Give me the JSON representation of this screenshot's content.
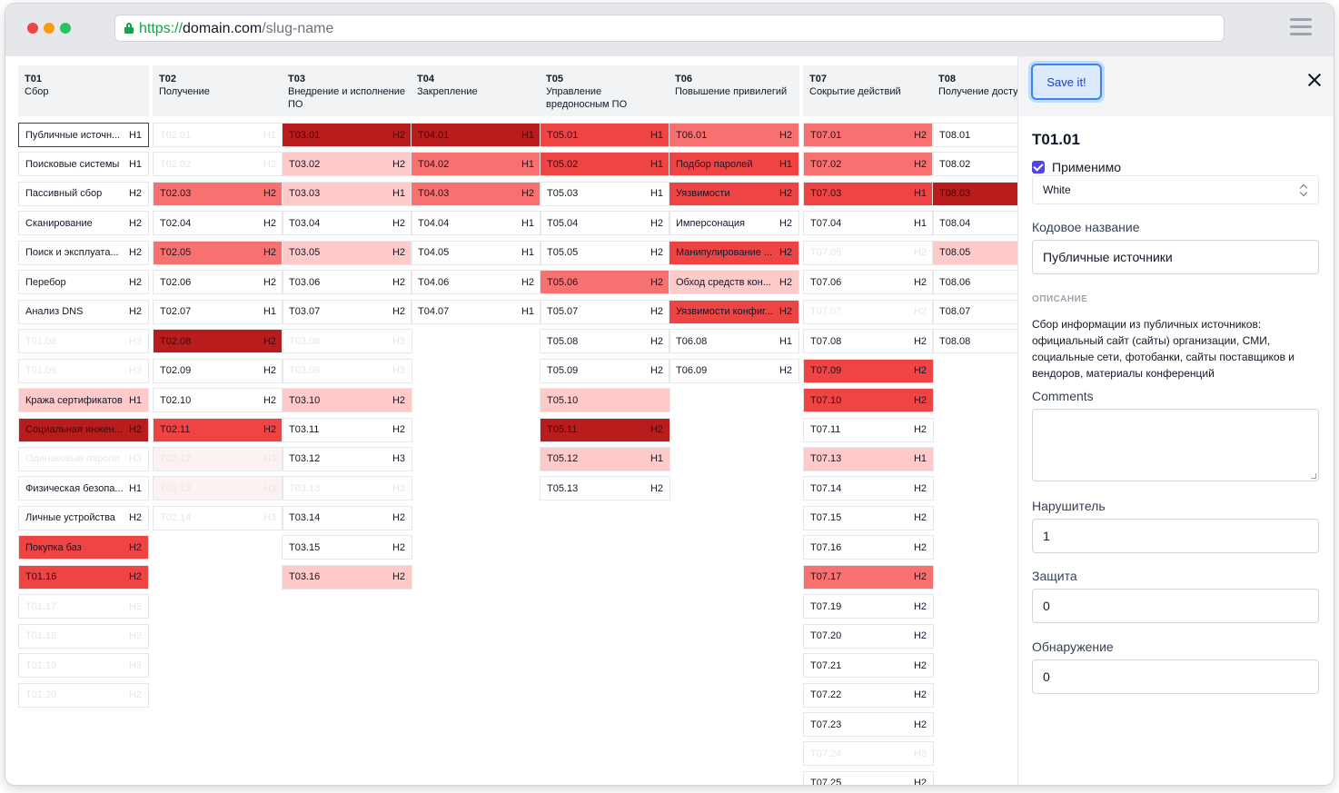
{
  "browser": {
    "url_protocol": "https://",
    "url_host": "domain.com",
    "url_path": "/slug-name"
  },
  "columns": [
    {
      "code": "T01",
      "title": "Сбор",
      "items": [
        {
          "id": "Публичные источн...",
          "level": "H1",
          "state": "sel"
        },
        {
          "id": "Поисковые системы",
          "level": "H1",
          "state": ""
        },
        {
          "id": "Пассивный сбор",
          "level": "H2",
          "state": ""
        },
        {
          "id": "Сканирование",
          "level": "H2",
          "state": ""
        },
        {
          "id": "Поиск и эксплуата...",
          "level": "H2",
          "state": ""
        },
        {
          "id": "Перебор",
          "level": "H2",
          "state": ""
        },
        {
          "id": "Анализ DNS",
          "level": "H2",
          "state": ""
        },
        {
          "id": "T01.08",
          "level": "H3",
          "state": "faded"
        },
        {
          "id": "T01.09",
          "level": "H3",
          "state": "faded"
        },
        {
          "id": "Кража сертификатов",
          "level": "H1",
          "state": "l1"
        },
        {
          "id": "Социальная инжен...",
          "level": "H2",
          "state": "l4"
        },
        {
          "id": "Одинаковые пароли",
          "level": "H3",
          "state": "faded"
        },
        {
          "id": "Физическая безопа...",
          "level": "H1",
          "state": ""
        },
        {
          "id": "Личные устройства",
          "level": "H2",
          "state": ""
        },
        {
          "id": "Покупка баз",
          "level": "H2",
          "state": "l3"
        },
        {
          "id": "T01.16",
          "level": "H2",
          "state": "l3"
        },
        {
          "id": "T01.17",
          "level": "H3",
          "state": "faded"
        },
        {
          "id": "T01.18",
          "level": "H2",
          "state": "faded"
        },
        {
          "id": "T01.19",
          "level": "H3",
          "state": "faded"
        },
        {
          "id": "T01.20",
          "level": "H2",
          "state": "faded"
        }
      ]
    },
    {
      "code": "T02",
      "title": "Получение",
      "items": [
        {
          "id": "T02.01",
          "level": "H1",
          "state": "faded"
        },
        {
          "id": "T02.02",
          "level": "H2",
          "state": "faded"
        },
        {
          "id": "T02.03",
          "level": "H2",
          "state": "l2"
        },
        {
          "id": "T02.04",
          "level": "H2",
          "state": ""
        },
        {
          "id": "T02.05",
          "level": "H2",
          "state": "l2"
        },
        {
          "id": "T02.06",
          "level": "H2",
          "state": ""
        },
        {
          "id": "T02.07",
          "level": "H1",
          "state": ""
        },
        {
          "id": "T02.08",
          "level": "H2",
          "state": "l4"
        },
        {
          "id": "T02.09",
          "level": "H2",
          "state": ""
        },
        {
          "id": "T02.10",
          "level": "H2",
          "state": ""
        },
        {
          "id": "T02.11",
          "level": "H2",
          "state": "l3"
        },
        {
          "id": "T02.12",
          "level": "H3",
          "state": "dim"
        },
        {
          "id": "T02.13",
          "level": "H3",
          "state": "dim"
        },
        {
          "id": "T02.14",
          "level": "H3",
          "state": "faded"
        }
      ]
    },
    {
      "code": "T03",
      "title": "Внедрение и исполнение ПО",
      "items": [
        {
          "id": "T03.01",
          "level": "H2",
          "state": "l4"
        },
        {
          "id": "T03.02",
          "level": "H2",
          "state": "l1"
        },
        {
          "id": "T03.03",
          "level": "H1",
          "state": "l1"
        },
        {
          "id": "T03.04",
          "level": "H2",
          "state": ""
        },
        {
          "id": "T03.05",
          "level": "H2",
          "state": "l1"
        },
        {
          "id": "T03.06",
          "level": "H2",
          "state": ""
        },
        {
          "id": "T03.07",
          "level": "H2",
          "state": ""
        },
        {
          "id": "T03.08",
          "level": "H3",
          "state": "faded"
        },
        {
          "id": "T03.09",
          "level": "H3",
          "state": "faded"
        },
        {
          "id": "T03.10",
          "level": "H2",
          "state": "l1"
        },
        {
          "id": "T03.11",
          "level": "H2",
          "state": ""
        },
        {
          "id": "T03.12",
          "level": "H3",
          "state": ""
        },
        {
          "id": "T03.13",
          "level": "H3",
          "state": "faded"
        },
        {
          "id": "T03.14",
          "level": "H2",
          "state": ""
        },
        {
          "id": "T03.15",
          "level": "H2",
          "state": ""
        },
        {
          "id": "T03.16",
          "level": "H2",
          "state": "l1"
        }
      ]
    },
    {
      "code": "T04",
      "title": "Закрепление",
      "items": [
        {
          "id": "T04.01",
          "level": "H1",
          "state": "l4"
        },
        {
          "id": "T04.02",
          "level": "H1",
          "state": "l2"
        },
        {
          "id": "T04.03",
          "level": "H2",
          "state": "l2"
        },
        {
          "id": "T04.04",
          "level": "H1",
          "state": ""
        },
        {
          "id": "T04.05",
          "level": "H1",
          "state": ""
        },
        {
          "id": "T04.06",
          "level": "H2",
          "state": ""
        },
        {
          "id": "T04.07",
          "level": "H1",
          "state": ""
        }
      ]
    },
    {
      "code": "T05",
      "title": "Управление вредоносным ПО",
      "items": [
        {
          "id": "T05.01",
          "level": "H1",
          "state": "l3"
        },
        {
          "id": "T05.02",
          "level": "H1",
          "state": "l3"
        },
        {
          "id": "T05.03",
          "level": "H1",
          "state": ""
        },
        {
          "id": "T05.04",
          "level": "H2",
          "state": ""
        },
        {
          "id": "T05.05",
          "level": "H2",
          "state": ""
        },
        {
          "id": "T05.06",
          "level": "H2",
          "state": "l2"
        },
        {
          "id": "T05.07",
          "level": "H2",
          "state": ""
        },
        {
          "id": "T05.08",
          "level": "H2",
          "state": ""
        },
        {
          "id": "T05.09",
          "level": "H2",
          "state": ""
        },
        {
          "id": "T05.10",
          "level": "",
          "state": "l1"
        },
        {
          "id": "T05.11",
          "level": "H2",
          "state": "l4"
        },
        {
          "id": "T05.12",
          "level": "H1",
          "state": "l1"
        },
        {
          "id": "T05.13",
          "level": "H2",
          "state": ""
        }
      ]
    },
    {
      "code": "T06",
      "title": "Повышение привилегий",
      "items": [
        {
          "id": "T06.01",
          "level": "H2",
          "state": "l2"
        },
        {
          "id": "Подбор паролей",
          "level": "H1",
          "state": "l3"
        },
        {
          "id": "Уязвимости",
          "level": "H2",
          "state": "l3"
        },
        {
          "id": "Имперсонация",
          "level": "H2",
          "state": ""
        },
        {
          "id": "Манипулирование ...",
          "level": "H2",
          "state": "l3"
        },
        {
          "id": "Обход средств кон...",
          "level": "H2",
          "state": "l1"
        },
        {
          "id": "Уязвимости конфиг...",
          "level": "H2",
          "state": "l3"
        },
        {
          "id": "T06.08",
          "level": "H1",
          "state": ""
        },
        {
          "id": "T06.09",
          "level": "H2",
          "state": ""
        }
      ]
    },
    {
      "code": "T07",
      "title": "Сокрытие действий",
      "items": [
        {
          "id": "T07.01",
          "level": "H2",
          "state": "l2"
        },
        {
          "id": "T07.02",
          "level": "H2",
          "state": "l2"
        },
        {
          "id": "T07.03",
          "level": "H1",
          "state": "l3"
        },
        {
          "id": "T07.04",
          "level": "H1",
          "state": ""
        },
        {
          "id": "T07.05",
          "level": "H2",
          "state": "faded"
        },
        {
          "id": "T07.06",
          "level": "H2",
          "state": ""
        },
        {
          "id": "T07.07",
          "level": "H2",
          "state": "faded"
        },
        {
          "id": "T07.08",
          "level": "H2",
          "state": ""
        },
        {
          "id": "T07.09",
          "level": "H2",
          "state": "l3"
        },
        {
          "id": "T07.10",
          "level": "H2",
          "state": "l3"
        },
        {
          "id": "T07.11",
          "level": "H2",
          "state": ""
        },
        {
          "id": "T07.13",
          "level": "H1",
          "state": "l1"
        },
        {
          "id": "T07.14",
          "level": "H2",
          "state": ""
        },
        {
          "id": "T07.15",
          "level": "H2",
          "state": ""
        },
        {
          "id": "T07.16",
          "level": "H2",
          "state": ""
        },
        {
          "id": "T07.17",
          "level": "H2",
          "state": "l2"
        },
        {
          "id": "T07.19",
          "level": "H2",
          "state": ""
        },
        {
          "id": "T07.20",
          "level": "H2",
          "state": ""
        },
        {
          "id": "T07.21",
          "level": "H2",
          "state": ""
        },
        {
          "id": "T07.22",
          "level": "H2",
          "state": ""
        },
        {
          "id": "T07.23",
          "level": "H2",
          "state": ""
        },
        {
          "id": "T07.24",
          "level": "H3",
          "state": "faded"
        },
        {
          "id": "T07.25",
          "level": "H2",
          "state": ""
        }
      ]
    },
    {
      "code": "T08",
      "title": "Получение доступа",
      "items": [
        {
          "id": "T08.01",
          "level": "",
          "state": ""
        },
        {
          "id": "T08.02",
          "level": "",
          "state": ""
        },
        {
          "id": "T08.03",
          "level": "",
          "state": "l4"
        },
        {
          "id": "T08.04",
          "level": "",
          "state": ""
        },
        {
          "id": "T08.05",
          "level": "",
          "state": "l1"
        },
        {
          "id": "T08.06",
          "level": "",
          "state": ""
        },
        {
          "id": "T08.07",
          "level": "",
          "state": ""
        },
        {
          "id": "T08.08",
          "level": "",
          "state": ""
        }
      ]
    }
  ],
  "panel": {
    "save_label": "Save it!",
    "title": "T01.01",
    "applicable_label": "Применимо",
    "select_value": "White",
    "codename_label": "Кодовое название",
    "codename_value": "Публичные источники",
    "description_label": "ОПИСАНИЕ",
    "description": "Сбор информации из публичных источников: официальный сайт (сайты) организации, СМИ, социальные сети, фотобанки, сайты поставщиков и вендоров, материалы конференций",
    "comments_label": "Comments",
    "intruder_label": "Нарушитель",
    "intruder_value": "1",
    "protection_label": "Защита",
    "protection_value": "0",
    "detection_label": "Обнаружение",
    "detection_value": "0"
  }
}
